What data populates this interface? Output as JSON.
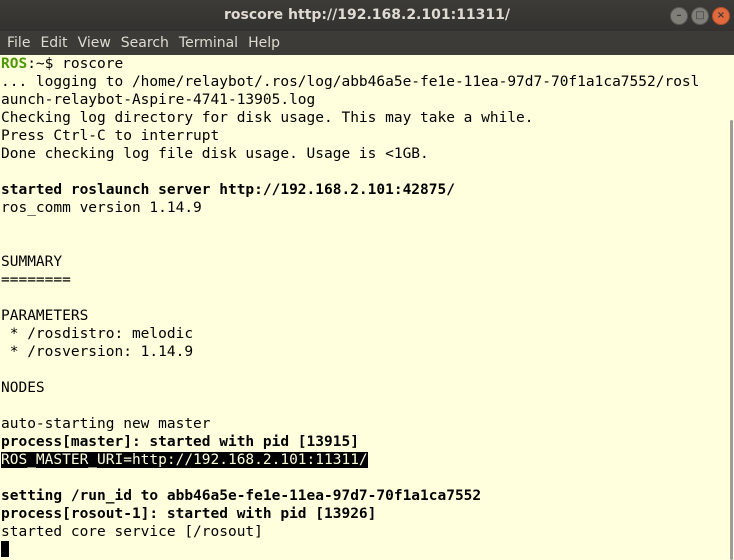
{
  "window": {
    "title": "roscore http://192.168.2.101:11311/",
    "minimize_glyph": "–",
    "maximize_glyph": "□",
    "close_glyph": "×"
  },
  "menu": [
    "File",
    "Edit",
    "View",
    "Search",
    "Terminal",
    "Help"
  ],
  "terminal": {
    "prompt_host": "ROS",
    "prompt_rest": ":~$ roscore",
    "lines": [
      "... logging to /home/relaybot/.ros/log/abb46a5e-fe1e-11ea-97d7-70f1a1ca7552/rosl",
      "aunch-relaybot-Aspire-4741-13905.log",
      "Checking log directory for disk usage. This may take a while.",
      "Press Ctrl-C to interrupt",
      "Done checking log file disk usage. Usage is <1GB.",
      "",
      "started roslaunch server http://192.168.2.101:42875/",
      "ros_comm version 1.14.9",
      "",
      "",
      "SUMMARY",
      "========",
      "",
      "PARAMETERS",
      " * /rosdistro: melodic",
      " * /rosversion: 1.14.9",
      "",
      "NODES",
      "",
      "auto-starting new master",
      "process[master]: started with pid [13915]",
      "ROS_MASTER_URI=http://192.168.2.101:11311/",
      "",
      "setting /run_id to abb46a5e-fe1e-11ea-97d7-70f1a1ca7552",
      "process[rosout-1]: started with pid [13926]",
      "started core service [/rosout]"
    ]
  },
  "colors": {
    "terminal_bg": "#ffffdd",
    "prompt_green": "#4e9a06",
    "close_button": "#e0693e"
  }
}
